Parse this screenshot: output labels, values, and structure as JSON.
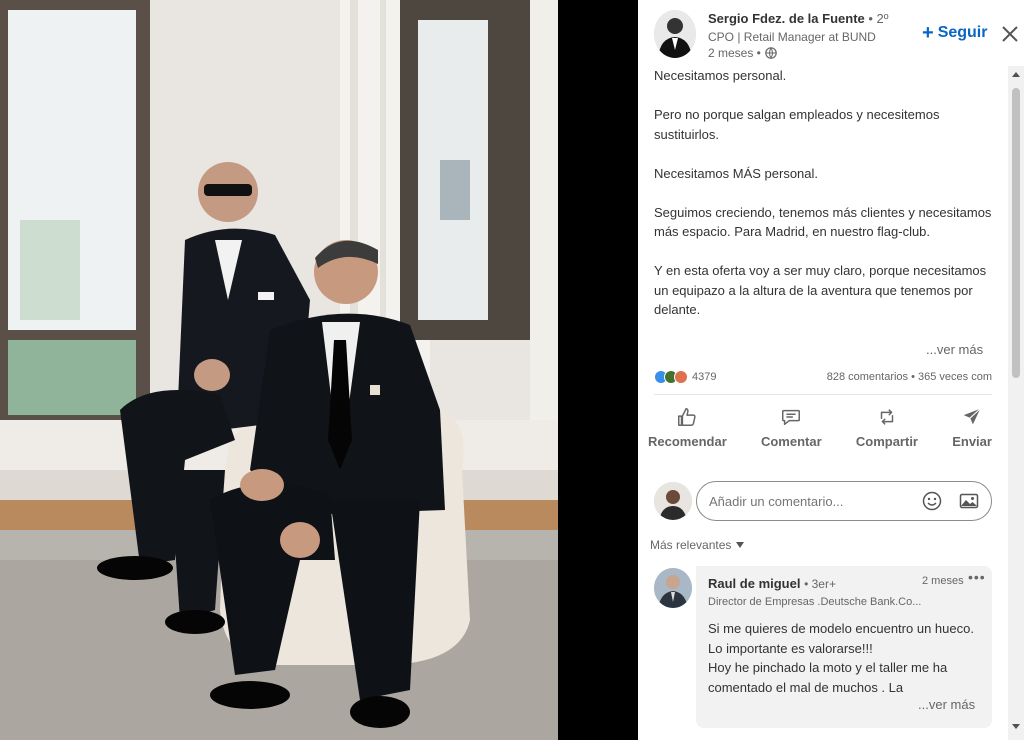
{
  "post": {
    "author": {
      "name": "Sergio Fdez. de la Fuente",
      "degree": "• 2º",
      "headline": "CPO | Retail Manager at BUND",
      "time": "2 meses •"
    },
    "follow_label": "Seguir",
    "paragraphs": [
      "Necesitamos personal.",
      "Pero no porque salgan empleados y necesitemos sustituirlos.",
      "Necesitamos MÁS personal.",
      "Seguimos creciendo, tenemos más clientes y necesitamos más espacio. Para Madrid, en nuestro flag-club.",
      "Y en esta oferta voy a ser muy claro, porque necesitamos un equipazo a la altura de la aventura que tenemos por delante."
    ],
    "see_more": "...ver más",
    "reactions_count": "4379",
    "comments_shares": "828 comentarios • 365 veces com",
    "actions": [
      {
        "label": "Recomendar",
        "icon": "like-icon"
      },
      {
        "label": "Comentar",
        "icon": "comment-icon"
      },
      {
        "label": "Compartir",
        "icon": "repost-icon"
      },
      {
        "label": "Enviar",
        "icon": "send-icon"
      }
    ]
  },
  "comment_box": {
    "placeholder": "Añadir un comentario..."
  },
  "sort_label": "Más relevantes",
  "comment": {
    "name": "Raul de miguel",
    "degree": "• 3er+",
    "time": "2 meses",
    "more": "•••",
    "headline": "Director de Empresas .Deutsche Bank.Co...",
    "lines": [
      "Si me quieres de modelo encuentro un hueco.",
      "Lo importante es valorarse!!!",
      "Hoy he pinchado la moto y el taller me ha comentado el mal de muchos . La"
    ],
    "see_more": "...ver más"
  },
  "colors": {
    "accent": "#0a66c2",
    "like": "#378fe9",
    "celebrate": "#44712e",
    "love": "#df704d"
  }
}
